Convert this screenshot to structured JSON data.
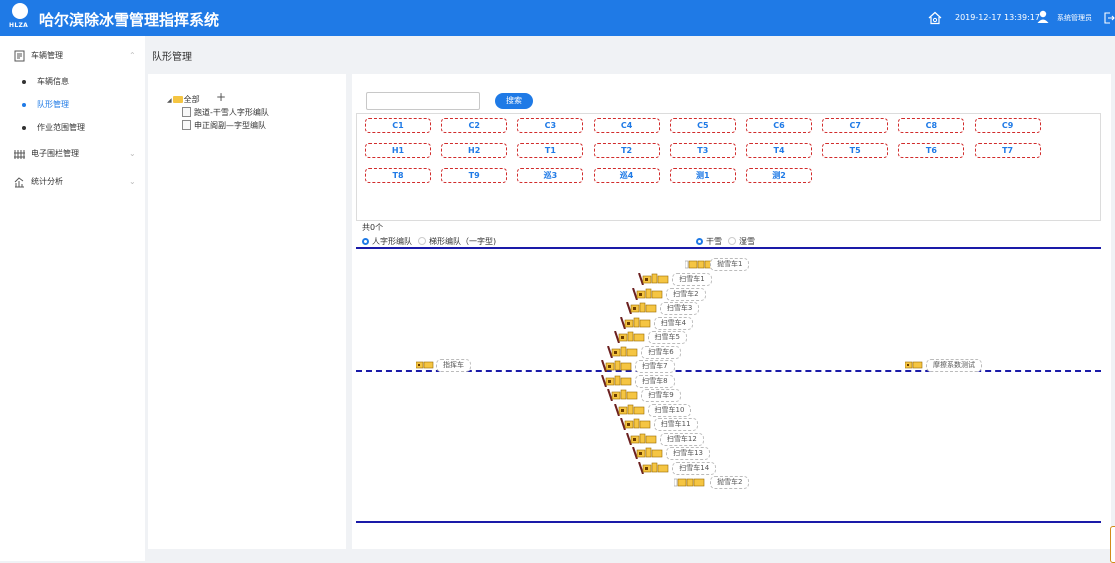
{
  "app": {
    "title": "哈尔滨除冰雪管理指挥系统",
    "logo_text": "HLZA",
    "datetime": "2019-12-17 13:39:17",
    "user": "系统管理员"
  },
  "sidebar": {
    "menus": [
      {
        "label": "车辆管理",
        "icon": "vehicle-doc-icon",
        "chevron": "⌃"
      },
      {
        "label": "电子围栏管理",
        "icon": "fence-icon",
        "chevron": "⌄"
      },
      {
        "label": "统计分析",
        "icon": "stats-icon",
        "chevron": "⌄"
      }
    ],
    "sub_items": [
      "车辆信息",
      "队形管理",
      "作业范围管理"
    ]
  },
  "page": {
    "title": "队形管理"
  },
  "tree": {
    "root": "全部",
    "add_symbol": "+",
    "nodes": [
      "跑道-干雪人字形编队",
      "申正阁副—字型编队"
    ]
  },
  "search": {
    "placeholder": "",
    "value": "",
    "button": "搜索"
  },
  "vehicles": [
    "C1",
    "C2",
    "C3",
    "C4",
    "C5",
    "C6",
    "C7",
    "C8",
    "C9",
    "H1",
    "H2",
    "T1",
    "T2",
    "T3",
    "T4",
    "T5",
    "T6",
    "T7",
    "T8",
    "T9",
    "巡3",
    "巡4",
    "测1",
    "测2"
  ],
  "count_text": "共0个",
  "formation_options": [
    {
      "label": "人字形编队",
      "selected": true
    },
    {
      "label": "梯形编队（一字型)",
      "selected": false
    }
  ],
  "snow_options": [
    {
      "label": "干雪",
      "selected": true
    },
    {
      "label": "湿雪",
      "selected": false
    }
  ],
  "diagram": {
    "command_vehicle": "指挥车",
    "test_vehicle": "摩擦系数测试",
    "top_blower": "抛雪车1",
    "bottom_blower": "抛雪车2",
    "sweepers": [
      "扫雪车1",
      "扫雪车2",
      "扫雪车3",
      "扫雪车4",
      "扫雪车5",
      "扫雪车6",
      "扫雪车7",
      "扫雪车8",
      "扫雪车9",
      "扫雪车10",
      "扫雪车11",
      "扫雪车12",
      "扫雪车13",
      "扫雪车14"
    ]
  },
  "colors": {
    "brand": "#1f7ae6",
    "vehicle_button_border": "#d12c2c",
    "road_line": "#1a1aa8",
    "truck_body": "#f5c542",
    "plow_blade": "#6b1f1f"
  }
}
